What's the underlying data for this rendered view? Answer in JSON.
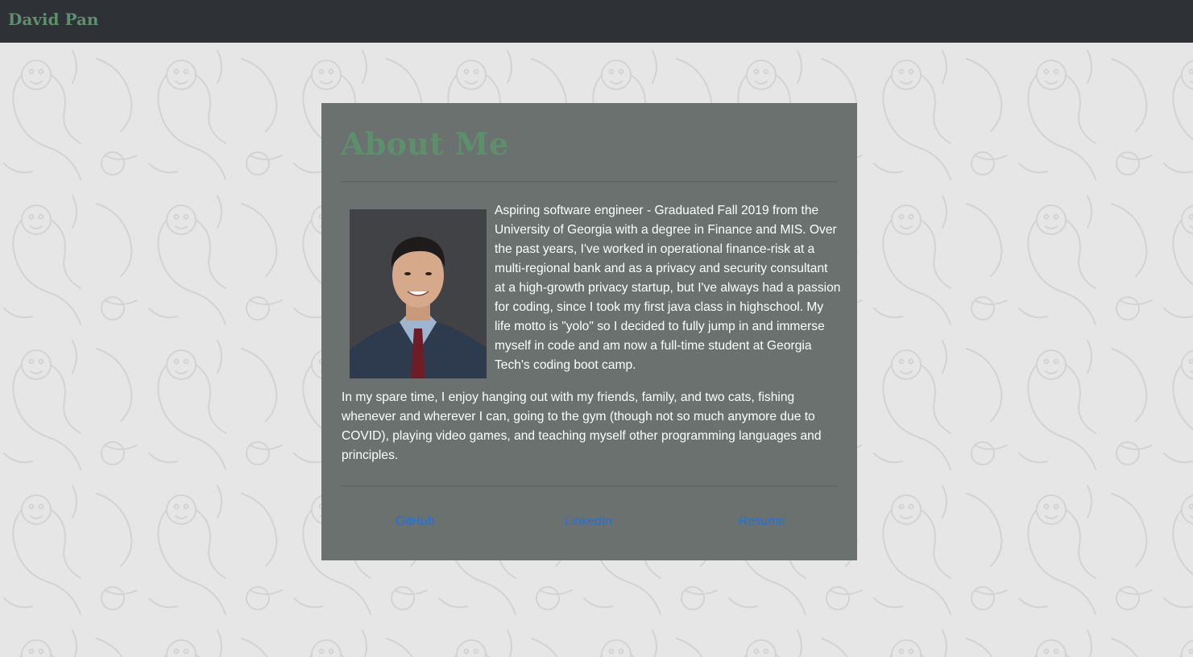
{
  "navbar": {
    "brand": "David Pan"
  },
  "about": {
    "title": "About Me",
    "bio_paragraph_1": "Aspiring software engineer - Graduated Fall 2019 from the University of Georgia with a degree in Finance and MIS. Over the past years, I've worked in operational finance-risk at a multi-regional bank and as a privacy and security consultant at a high-growth privacy startup, but I've always had a passion for coding, since I took my first java class in highschool. My life motto is \"yolo\" so I decided to fully jump in and immerse myself in code and am now a full-time student at Georgia Tech's coding boot camp.",
    "bio_paragraph_2": "In my spare time, I enjoy hanging out with my friends, family, and two cats, fishing whenever and wherever I can, going to the gym (though not so much anymore due to COVID), playing video games, and teaching myself other programming languages and principles."
  },
  "links": {
    "github": "GitHub",
    "linkedin": "LinkedIn",
    "resume": "Resume"
  },
  "colors": {
    "navbar_bg": "#2e3236",
    "brand": "#5e8f6c",
    "card_bg": "#6a716f",
    "link": "#1a73e8",
    "page_bg": "#e6e6e6"
  }
}
